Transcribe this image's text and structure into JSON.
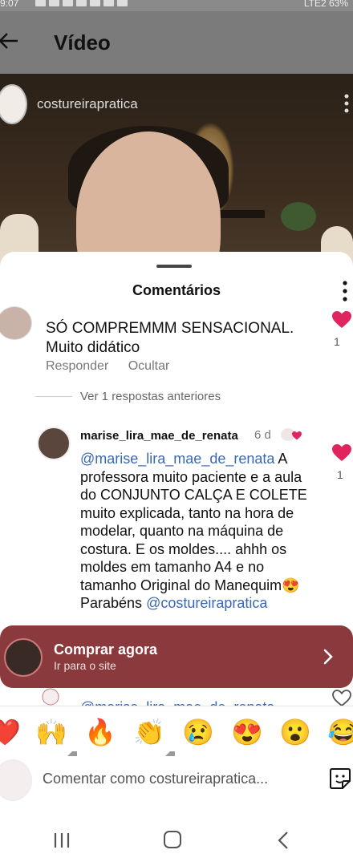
{
  "status_bar": {
    "time": "9:07",
    "battery": "63%",
    "network": "LTE2"
  },
  "header": {
    "title": "Vídeo"
  },
  "video": {
    "channel_name": "costureirapratica"
  },
  "comments_sheet": {
    "title": "Comentários",
    "comments": [
      {
        "text": "SÓ COMPREMMM SENSACIONAL. Muito didático",
        "reply_label": "Responder",
        "hide_label": "Ocultar",
        "like_count": "1"
      },
      {
        "username": "marise_lira_mae_de_renata",
        "time": "6 d",
        "mention": "@marise_lira_mae_de_renata",
        "text": " A professora muito paciente e a aula do CONJUNTO CALÇA E COLETE muito explicada, tanto na hora de modelar, quanto  na máquina de costura. E os moldes.... ahhh os moldes em tamanho A4 e no tamanho Original do Manequim😍",
        "closing": "Parabéns ",
        "closing_mention": "@costureirapratica",
        "like_count": "1"
      }
    ],
    "previous_replies": "Ver 1 respostas anteriores",
    "partial_reply_mention": "@marise_lira_mae_de_renata"
  },
  "ad": {
    "title": "Comprar agora",
    "subtitle": "Ir para o site"
  },
  "emoji_bar": [
    "❤️",
    "🙌",
    "🔥",
    "👏",
    "😢",
    "😍",
    "😮",
    "😂"
  ],
  "comment_input": {
    "placeholder": "Comentar como costureirapratica..."
  },
  "colors": {
    "ad_background": "#8a3a3d",
    "like_red": "#e0245e",
    "mention_blue": "#3a67b5"
  }
}
